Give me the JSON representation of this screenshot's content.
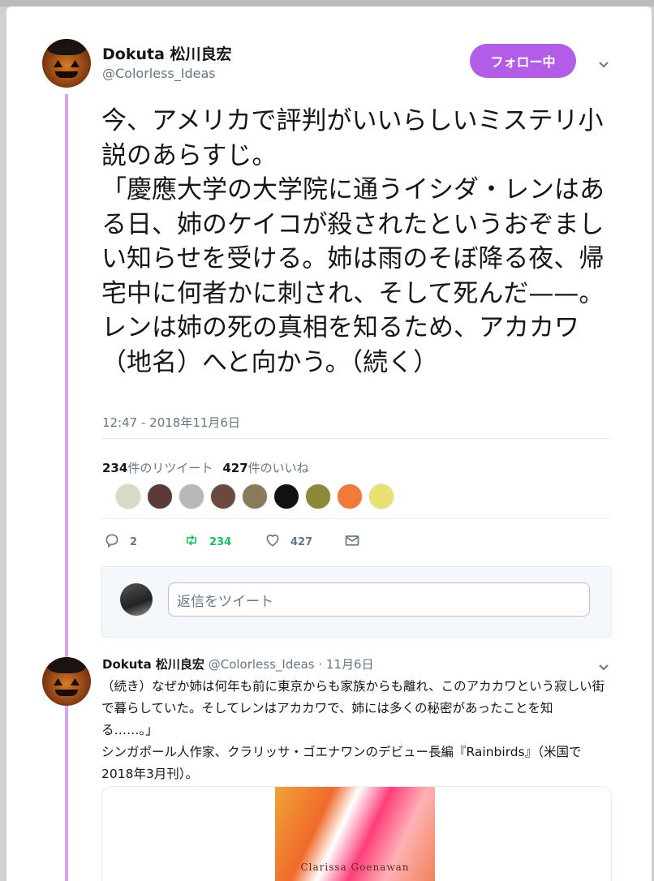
{
  "tweet": {
    "author_name": "Dokuta 松川良宏",
    "author_handle": "@Colorless_Ideas",
    "follow_label": "フォロー中",
    "text": "今、アメリカで評判がいいらしいミステリ小説のあらすじ。\n「慶應大学の大学院に通うイシダ・レンはある日、姉のケイコが殺されたというおぞましい知らせを受ける。姉は雨のそぼ降る夜、帰宅中に何者かに刺され、そして死んだ——。レンは姉の死の真相を知るため、アカカワ（地名）へと向かう。（続く）",
    "timestamp": "12:47 - 2018年11月6日",
    "retweet_count": "234",
    "retweet_label": "件のリツイート",
    "like_count": "427",
    "like_label": "件のいいね",
    "actions": {
      "replies": "2",
      "retweets": "234",
      "likes": "427"
    },
    "likers": [
      "#d9d9c8",
      "#5a3a3a",
      "#b8b8b8",
      "#6a4a3a",
      "#8a7a5a",
      "#111111",
      "#8a8a3a",
      "#f07a3a",
      "#e8e070"
    ]
  },
  "reply": {
    "placeholder": "返信をツイート"
  },
  "tweet2": {
    "author_name": "Dokuta 松川良宏",
    "author_handle": "@Colorless_Ideas",
    "date": "· 11月6日",
    "text": "（続き）なぜか姉は何年も前に東京からも家族からも離れ、このアカカワという寂しい街で暮らしていた。そしてレンはアカカワで、姉には多くの秘密があったことを知る……。」\nシンガポール人作家、クラリッサ・ゴエナワンのデビュー長編『Rainbirds』（米国で2018年3月刊）。",
    "book_author": "Clarissa Goenawan"
  },
  "colors": {
    "accent": "#b25ce8",
    "thread": "#d6a6f0",
    "retweet_green": "#17bf63"
  }
}
